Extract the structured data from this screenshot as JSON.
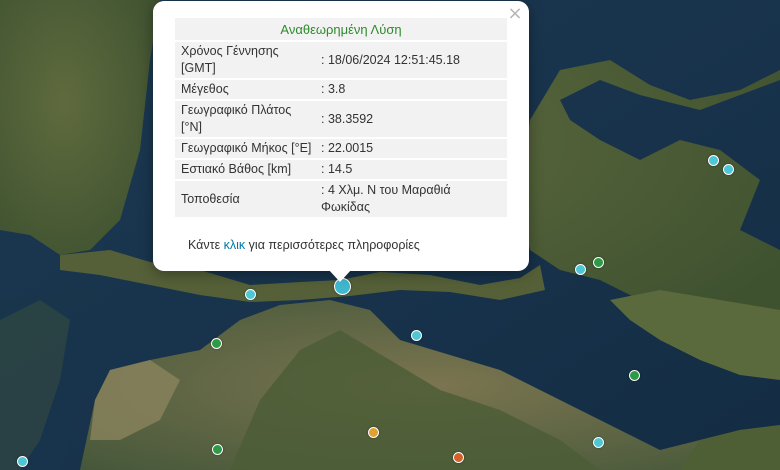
{
  "popup": {
    "title": "Αναθεωρημένη Λύση",
    "close_symbol": "×",
    "rows": [
      {
        "label": "Χρόνος Γέννησης [GMT]",
        "value": ": 18/06/2024 12:51:45.18"
      },
      {
        "label": "Μέγεθος",
        "value": ": 3.8"
      },
      {
        "label": "Γεωγραφικό Πλάτος [°N]",
        "value": ": 38.3592"
      },
      {
        "label": "Γεωγραφικό Μήκος [°E]",
        "value": ": 22.0015"
      },
      {
        "label": "Εστιακό Βάθος [km]",
        "value": ": 14.5"
      },
      {
        "label": "Τοποθεσία",
        "value": ": 4 Χλμ. N του Μαραθιά Φωκίδας"
      }
    ],
    "more_prefix": "Κάντε ",
    "more_link": "κλικ",
    "more_suffix": " για περισσότερες πληροφορίες"
  },
  "colors": {
    "marker_cyan": "#4fc6d6",
    "marker_green": "#2e9a45",
    "marker_orange": "#e0a032",
    "marker_red": "#d4602a",
    "selected_marker": "#3fb8d0"
  },
  "markers": [
    "cyan",
    "cyan",
    "cyan",
    "cyan",
    "cyan",
    "cyan",
    "green",
    "green",
    "green",
    "green",
    "green",
    "orange",
    "red",
    "cyan",
    "cyan-selected"
  ]
}
